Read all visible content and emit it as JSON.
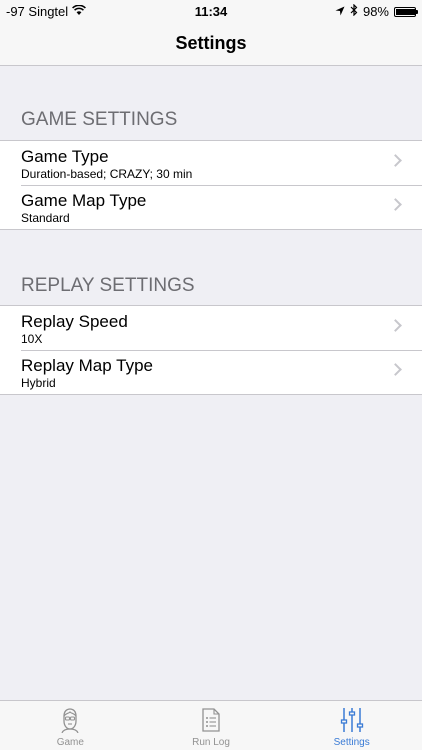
{
  "status_bar": {
    "carrier": "-97 Singtel",
    "time": "11:34",
    "battery_text": "98%",
    "battery_level": 0.98
  },
  "nav": {
    "title": "Settings"
  },
  "sections": [
    {
      "header": "GAME SETTINGS",
      "rows": [
        {
          "title": "Game Type",
          "subtitle": "Duration-based; CRAZY; 30 min"
        },
        {
          "title": "Game Map Type",
          "subtitle": "Standard"
        }
      ]
    },
    {
      "header": "REPLAY SETTINGS",
      "rows": [
        {
          "title": "Replay Speed",
          "subtitle": "10X"
        },
        {
          "title": "Replay Map Type",
          "subtitle": "Hybrid"
        }
      ]
    }
  ],
  "tabs": [
    {
      "label": "Game",
      "icon": "face-icon"
    },
    {
      "label": "Run Log",
      "icon": "list-icon"
    },
    {
      "label": "Settings",
      "icon": "sliders-icon",
      "active": true
    }
  ],
  "colors": {
    "accent": "#3a7bd5",
    "background": "#efeff4"
  }
}
